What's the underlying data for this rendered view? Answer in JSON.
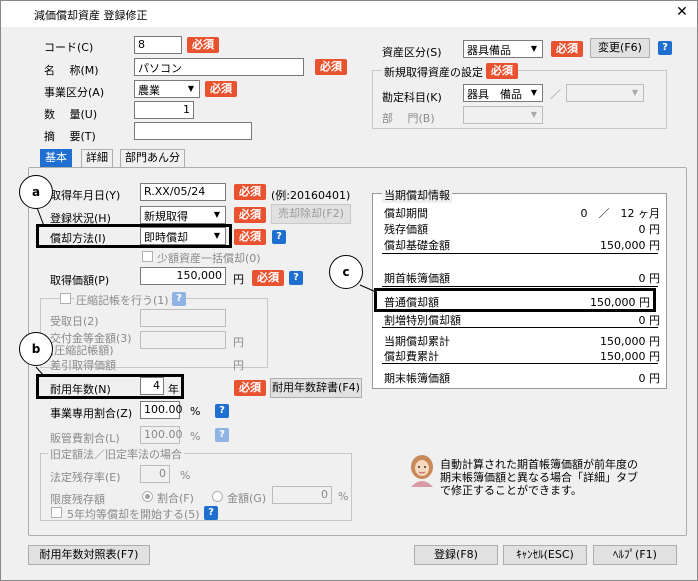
{
  "window": {
    "title": "減価償却資産 登録修正",
    "close": "✕"
  },
  "required": "必須",
  "header": {
    "code_label": "コード(C)",
    "code_value": "8",
    "name_label": "名　 称(M)",
    "name_value": "パソコン",
    "business_label": "事業区分(A)",
    "business_value": "農業",
    "qty_label": "数　 量(U)",
    "qty_value": "1",
    "summary_label": "摘　 要(T)",
    "summary_value": "",
    "asset_class_label": "資産区分(S)",
    "asset_class_value": "器具備品",
    "change_button": "変更(F6)",
    "new_asset_group": "新規取得資産の設定",
    "account_label": "勘定科目(K)",
    "account_value": "器具　備品",
    "dept_label": "部　 門(B)",
    "slash": "／"
  },
  "tabs": [
    "基本",
    "詳細",
    "部門あん分"
  ],
  "basic": {
    "acq_date_label": "取得年月日(Y)",
    "acq_date_value": "R.XX/05/24",
    "acq_date_example": "(例:20160401)",
    "reg_status_label": "登録状況(H)",
    "reg_status_value": "新規取得",
    "sale_button": "売却除却(F2)",
    "method_label": "償却方法(I)",
    "method_value": "即時償却",
    "small_asset": "少額資産一括償却(0)",
    "price_label": "取得価額(P)",
    "price_value": "150,000",
    "yen": "円",
    "compressed_label": "圧縮記帳を行う(1)",
    "received_label": "受取日(2)",
    "grant_label": "交付金等金額(3)",
    "grant_sub": "(圧縮記帳額)",
    "deducted_label": "差引取得価額",
    "life_label": "耐用年数(N)",
    "life_value": "4",
    "life_unit": "年",
    "life_dict_button": "耐用年数辞書(F4)",
    "business_ratio_label": "事業専用割合(Z)",
    "business_ratio_value": "100.00",
    "percent": "%",
    "sales_ratio_label": "販管費割合(L)",
    "sales_ratio_value": "100.00",
    "old_law_group": "旧定額法／旧定率法の場合",
    "legal_rate_label": "法定残存率(E)",
    "legal_rate_value": "0",
    "limit_label": "限度残存額",
    "radio_ratio": "割合(F)",
    "radio_amount": "金額(G)",
    "limit_value": "0",
    "five_year": "5年均等償却を開始する(5)"
  },
  "depreciation": {
    "title": "当期償却情報",
    "rows": [
      {
        "label": "償却期間",
        "value": "0　／　12 ヶ月"
      },
      {
        "label": "残存価額",
        "value": "0 円"
      },
      {
        "label": "償却基礎金額",
        "value": "150,000 円"
      },
      {
        "label": "期首帳簿価額",
        "value": "0 円"
      },
      {
        "label": "普通償却額",
        "value": "150,000 円"
      },
      {
        "label": "割増特別償却額",
        "value": "0 円"
      },
      {
        "label": "当期償却累計",
        "value": "150,000 円"
      },
      {
        "label": "償却費累計",
        "value": "150,000 円"
      },
      {
        "label": "期末帳簿価額",
        "value": "0 円"
      }
    ]
  },
  "callouts": {
    "a": "a",
    "b": "b",
    "c": "c"
  },
  "help_q": "?",
  "note": "自動計算された期首帳簿価額が前年度の期末帳簿価額と異なる場合「詳細」タブで修正することができます。",
  "note_lines": [
    "自動計算された期首帳簿価額が前年度の",
    "期末帳簿価額と異なる場合「詳細」タブ",
    "で修正することができます。"
  ],
  "footer": {
    "life_table_button": "耐用年数対照表(F7)",
    "register_button": "登録(F8)",
    "cancel_button": "ｷｬﾝｾﾙ(ESC)",
    "help_button": "ﾍﾙﾌﾟ(F1)"
  }
}
